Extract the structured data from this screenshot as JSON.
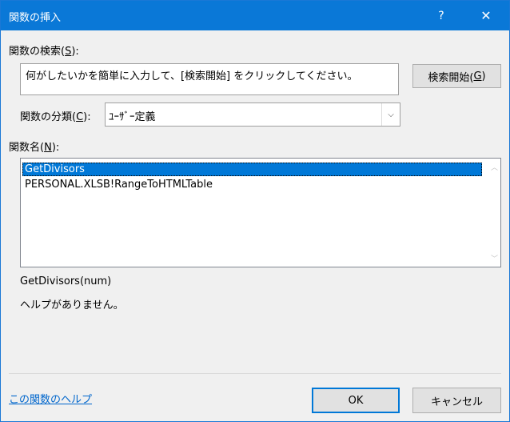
{
  "window": {
    "title": "関数の挿入",
    "help_glyph": "?",
    "close_glyph": "✕"
  },
  "search": {
    "label_prefix": "関数の検索(",
    "label_key": "S",
    "label_suffix": "):",
    "value": "何がしたいかを簡単に入力して、[検索開始] をクリックしてください。",
    "button_prefix": "検索開始(",
    "button_key": "G",
    "button_suffix": ")"
  },
  "category": {
    "label_prefix": "関数の分類(",
    "label_key": "C",
    "label_suffix": "):",
    "selected": "ﾕｰｻﾞｰ定義",
    "arrow_glyph": "⌵"
  },
  "functions": {
    "label_prefix": "関数名(",
    "label_key": "N",
    "label_suffix": "):",
    "items": [
      "GetDivisors",
      "PERSONAL.XLSB!RangeToHTMLTable"
    ],
    "selected_index": 0
  },
  "details": {
    "signature": "GetDivisors(num)",
    "description": "ヘルプがありません。"
  },
  "footer": {
    "help_link": "この関数のヘルプ",
    "ok_label": "OK",
    "cancel_label": "キャンセル"
  },
  "colors": {
    "titlebar": "#0a78d7",
    "selection": "#0078d7",
    "link": "#0066cc"
  }
}
